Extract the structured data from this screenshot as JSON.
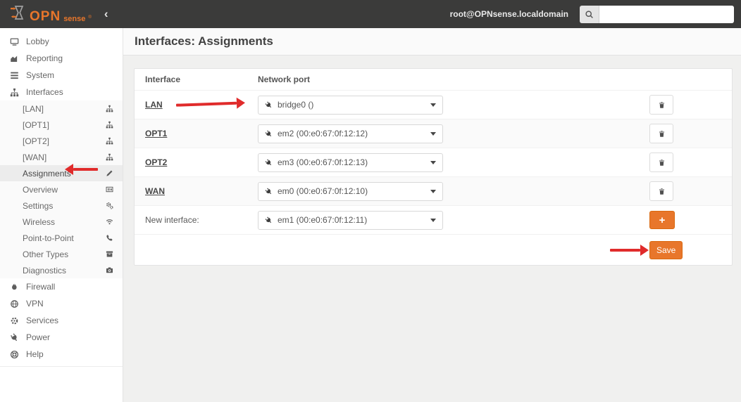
{
  "header": {
    "brand_primary": "OPN",
    "brand_secondary": "sense",
    "brand_reg": "®",
    "collapse_icon": "‹",
    "user": "root@OPNsense.localdomain",
    "search_placeholder": ""
  },
  "sidebar": {
    "items": [
      {
        "label": "Lobby",
        "icon": "desktop-icon"
      },
      {
        "label": "Reporting",
        "icon": "area-chart-icon"
      },
      {
        "label": "System",
        "icon": "tasks-icon"
      },
      {
        "label": "Interfaces",
        "icon": "sitemap-icon",
        "expanded": true
      },
      {
        "label": "Firewall",
        "icon": "fire-icon"
      },
      {
        "label": "VPN",
        "icon": "globe-icon"
      },
      {
        "label": "Services",
        "icon": "gear-icon"
      },
      {
        "label": "Power",
        "icon": "plug-icon"
      },
      {
        "label": "Help",
        "icon": "life-ring-icon"
      }
    ],
    "interfaces_children": [
      {
        "label": "[LAN]",
        "icon": "sitemap-icon"
      },
      {
        "label": "[OPT1]",
        "icon": "sitemap-icon"
      },
      {
        "label": "[OPT2]",
        "icon": "sitemap-icon"
      },
      {
        "label": "[WAN]",
        "icon": "sitemap-icon"
      },
      {
        "label": "Assignments",
        "icon": "pencil-icon",
        "active": true
      },
      {
        "label": "Overview",
        "icon": "overview-icon"
      },
      {
        "label": "Settings",
        "icon": "cogs-icon"
      },
      {
        "label": "Wireless",
        "icon": "wifi-icon"
      },
      {
        "label": "Point-to-Point",
        "icon": "phone-icon"
      },
      {
        "label": "Other Types",
        "icon": "archive-icon"
      },
      {
        "label": "Diagnostics",
        "icon": "camera-icon"
      }
    ]
  },
  "main": {
    "title": "Interfaces: Assignments",
    "table": {
      "columns": [
        "Interface",
        "Network port"
      ],
      "rows": [
        {
          "interface": "LAN",
          "network_port": "bridge0 ()",
          "action": "delete"
        },
        {
          "interface": "OPT1",
          "network_port": "em2 (00:e0:67:0f:12:12)",
          "action": "delete"
        },
        {
          "interface": "OPT2",
          "network_port": "em3 (00:e0:67:0f:12:13)",
          "action": "delete"
        },
        {
          "interface": "WAN",
          "network_port": "em0 (00:e0:67:0f:12:10)",
          "action": "delete"
        },
        {
          "interface": "New interface:",
          "network_port": "em1 (00:e0:67:0f:12:11)",
          "action": "add"
        }
      ],
      "add_button_label": "+",
      "save_button_label": "Save"
    }
  },
  "annotations": {
    "arrow_color": "#e02b2b",
    "arrows": [
      {
        "name": "arrow-to-lan-network-port",
        "direction": "right"
      },
      {
        "name": "arrow-to-assignments-menu",
        "direction": "left"
      },
      {
        "name": "arrow-to-save-button",
        "direction": "right"
      }
    ]
  },
  "colors": {
    "accent_orange": "#e8762b",
    "topbar_bg": "#3b3b3a",
    "arrow_red": "#e02b2b"
  }
}
